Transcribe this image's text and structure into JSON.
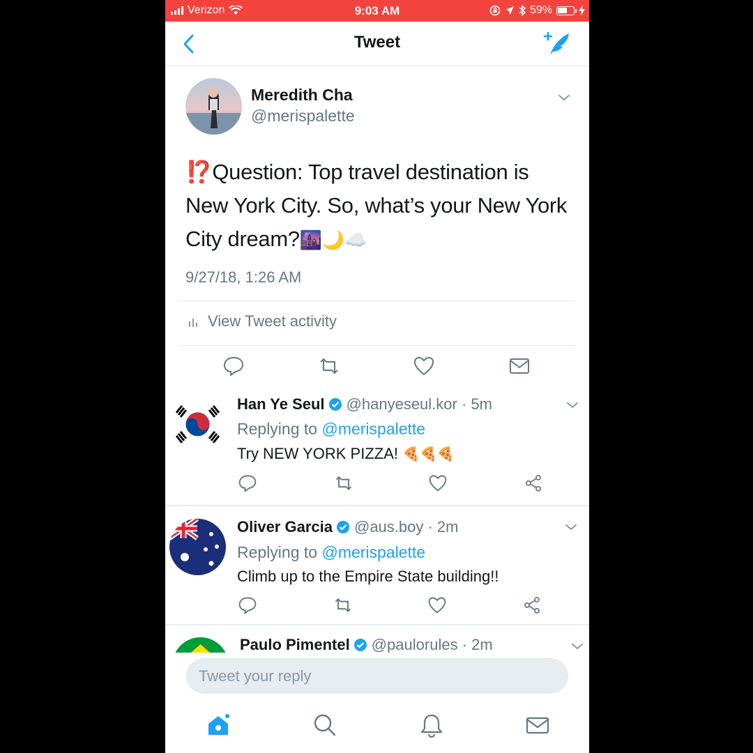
{
  "status_bar": {
    "carrier": "Verizon",
    "time": "9:03 AM",
    "battery": "59%"
  },
  "nav": {
    "title": "Tweet"
  },
  "main_tweet": {
    "author_name": "Meredith Cha",
    "author_handle": "@merispalette",
    "text_lead": "⁉️",
    "text_body": "Question: Top travel destination is New York City. So, what’s your New York City dream?",
    "text_emoji": "🌆🌙☁️",
    "timestamp": "9/27/18, 1:26 AM",
    "activity_label": "View Tweet activity"
  },
  "replies": [
    {
      "name": "Han Ye Seul",
      "handle": "@hanyeseul.kor · 5m",
      "replying_prefix": "Replying to",
      "replying_to": "@merispalette",
      "text": "Try NEW YORK PIZZA! ",
      "emoji": "🍕🍕🍕",
      "avatar": "south-korea-flag"
    },
    {
      "name": "Oliver Garcia",
      "handle": "@aus.boy · 2m",
      "replying_prefix": "Replying to",
      "replying_to": "@merispalette",
      "text": "Climb up to the Empire State building!!",
      "emoji": "",
      "avatar": "australia-flag"
    },
    {
      "name": "Paulo Pimentel",
      "handle": "@paulorules · 2m",
      "avatar": "brazil-flag"
    }
  ],
  "reply_box": {
    "placeholder": "Tweet your reply"
  },
  "colors": {
    "status_bar": "#f4433e",
    "accent": "#1da1f2",
    "secondary_text": "#657786"
  }
}
